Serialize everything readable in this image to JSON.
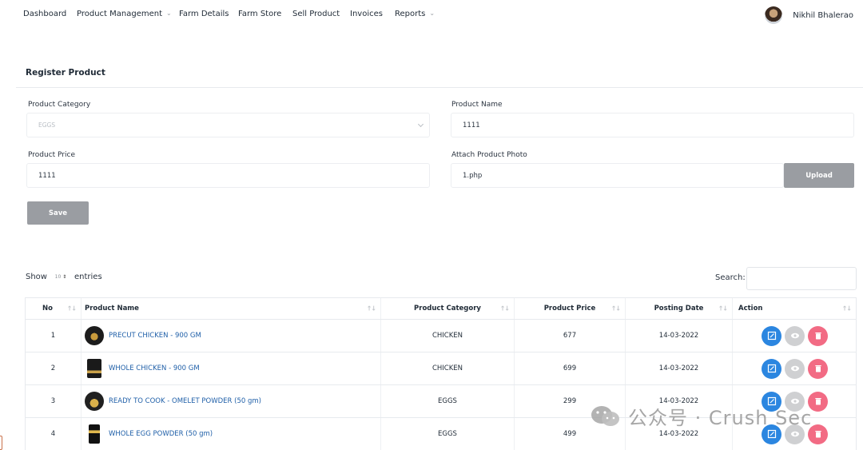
{
  "nav": {
    "items": [
      {
        "label": "Dashboard",
        "dropdown": false
      },
      {
        "label": "Product Management",
        "dropdown": true
      },
      {
        "label": "Farm Details",
        "dropdown": false
      },
      {
        "label": "Farm Store",
        "dropdown": false
      },
      {
        "label": "Sell Product",
        "dropdown": false
      },
      {
        "label": "Invoices",
        "dropdown": false
      },
      {
        "label": "Reports",
        "dropdown": true
      }
    ],
    "user_name": "Nikhil Bhalerao"
  },
  "form": {
    "title": "Register Product",
    "category_label": "Product Category",
    "category_value": "EGGS",
    "name_label": "Product Name",
    "name_value": "1111",
    "price_label": "Product Price",
    "price_value": "1111",
    "photo_label": "Attach Product Photo",
    "photo_value": "1.php",
    "upload_label": "Upload",
    "save_label": "Save"
  },
  "datatable": {
    "show_label": "Show",
    "entries_value": "10",
    "entries_label": "entries",
    "search_label": "Search:",
    "columns": [
      "No",
      "Product Name",
      "Product Category",
      "Product Price",
      "Posting Date",
      "Action"
    ],
    "rows": [
      {
        "no": "1",
        "name": "PRECUT CHICKEN - 900 GM",
        "category": "CHICKEN",
        "price": "677",
        "date": "14-03-2022"
      },
      {
        "no": "2",
        "name": "WHOLE CHICKEN - 900 GM",
        "category": "CHICKEN",
        "price": "699",
        "date": "14-03-2022"
      },
      {
        "no": "3",
        "name": "READY TO COOK - OMELET POWDER (50 gm)",
        "category": "EGGS",
        "price": "299",
        "date": "14-03-2022"
      },
      {
        "no": "4",
        "name": "WHOLE EGG POWDER (50 gm)",
        "category": "EGGS",
        "price": "499",
        "date": "14-03-2022"
      }
    ]
  },
  "watermark": {
    "text": "公众号 · Crush Sec"
  },
  "colors": {
    "edit": "#2b86e0",
    "view": "#cfd0d2",
    "delete": "#f26b84",
    "button_gray": "#9a9da2",
    "link": "#1f5fa8"
  }
}
